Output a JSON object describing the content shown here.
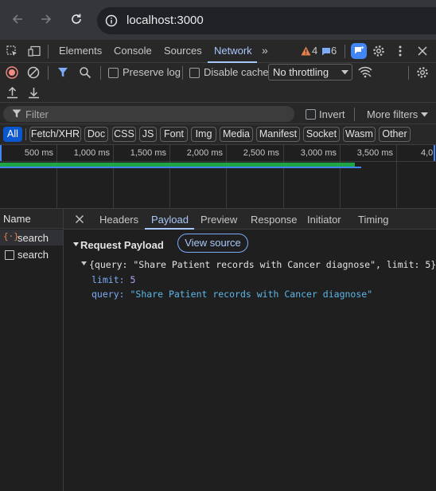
{
  "browser": {
    "url": "localhost:3000"
  },
  "devtools": {
    "tabs": [
      "Elements",
      "Console",
      "Sources",
      "Network"
    ],
    "active_tab": "Network",
    "warnings_count": "4",
    "messages_count": "6",
    "controls": {
      "preserve_log": "Preserve log",
      "disable_cache": "Disable cache",
      "throttling": "No throttling"
    },
    "filter": {
      "placeholder": "Filter",
      "invert": "Invert",
      "more_filters": "More filters"
    },
    "type_filters": [
      "All",
      "Fetch/XHR",
      "Doc",
      "CSS",
      "JS",
      "Font",
      "Img",
      "Media",
      "Manifest",
      "Socket",
      "Wasm",
      "Other"
    ],
    "active_type": "All",
    "timeline": {
      "ticks": [
        "500 ms",
        "1,000 ms",
        "1,500 ms",
        "2,000 ms",
        "2,500 ms",
        "3,000 ms",
        "3,500 ms",
        "4,0"
      ]
    },
    "requests": {
      "header": "Name",
      "items": [
        {
          "name": "search",
          "selected": true
        },
        {
          "name": "search",
          "selected": false
        }
      ]
    },
    "detail": {
      "tabs": [
        "Headers",
        "Payload",
        "Preview",
        "Response",
        "Initiator",
        "Timing"
      ],
      "active_tab": "Payload",
      "section_title": "Request Payload",
      "view_source": "View source",
      "summary": "{query: \"Share Patient records with Cancer diagnose\", limit: 5}",
      "fields": [
        {
          "key": "limit",
          "value": "5"
        },
        {
          "key": "query",
          "value": "\"Share Patient records with Cancer diagnose\""
        }
      ]
    }
  },
  "colors": {
    "accent": "#a8c7fa",
    "chip_active": "#0b57d0",
    "record": "#f28b82",
    "warning": "#fbbc04",
    "message": "#7cacf8",
    "timeline_bar_green": "#1ea446",
    "timeline_bar_blue": "#4285f4"
  }
}
